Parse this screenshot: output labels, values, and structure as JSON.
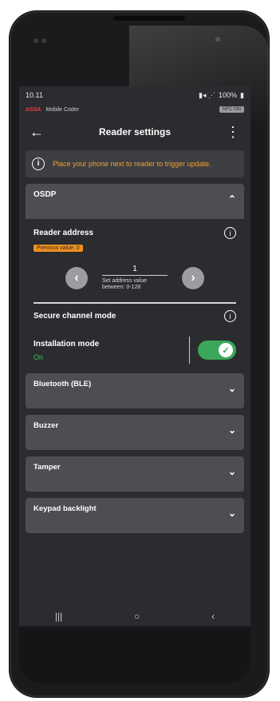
{
  "status": {
    "time": "10.11",
    "battery": "100%"
  },
  "app": {
    "brand": "ASSA",
    "name": "Mobile Coder",
    "badge": "NFC ON"
  },
  "toolbar": {
    "title": "Reader settings"
  },
  "notice": {
    "text": "Place your phone next to reader to trigger update."
  },
  "osdp": {
    "title": "OSDP",
    "reader_address_label": "Reader address",
    "previous_value": "Previous value: 0",
    "address_value": "1",
    "address_help": "Set address value between: 0-128",
    "secure_channel_label": "Secure channel mode",
    "installation_mode_label": "Installation mode",
    "installation_state": "On",
    "installation_on": true
  },
  "sections": [
    {
      "label": "Bluetooth (BLE)"
    },
    {
      "label": "Buzzer"
    },
    {
      "label": "Tamper"
    },
    {
      "label": "Keypad backlight"
    }
  ],
  "colors": {
    "accent_orange": "#f0a030",
    "toggle_green": "#3aa75a",
    "panel": "#4d4e52",
    "background": "#2b2c2f"
  }
}
